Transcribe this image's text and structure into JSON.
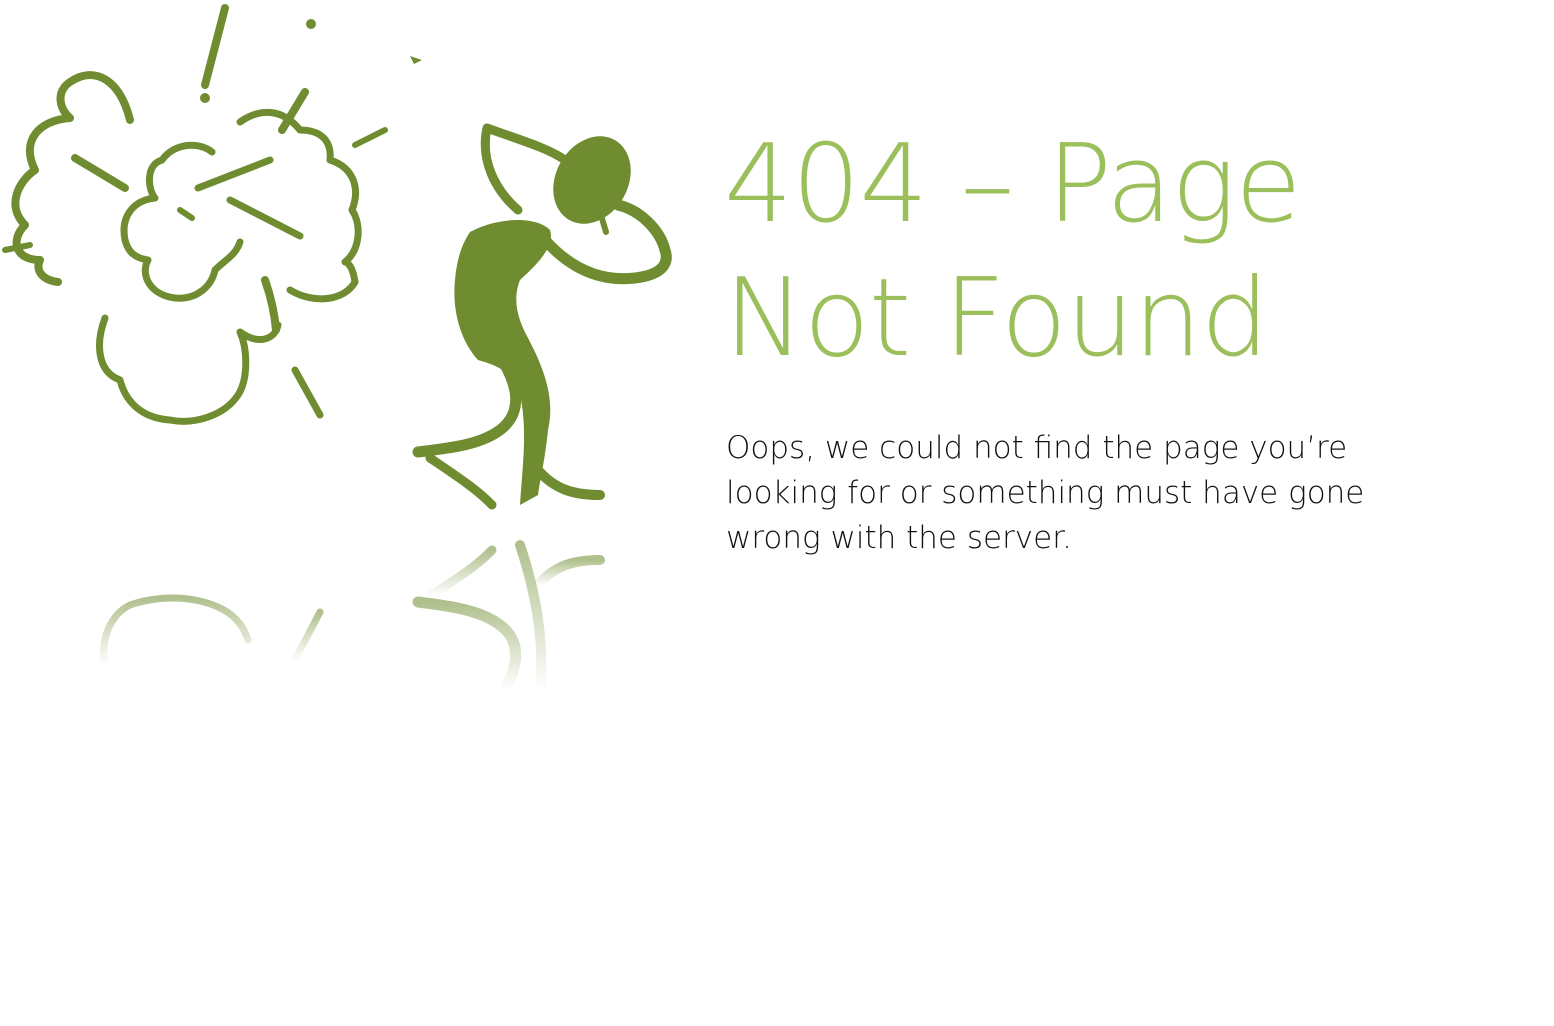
{
  "error_page": {
    "title": "404 – Page Not Found",
    "message": "Oops, we could not find the page you’re looking for or something must have gone wrong with the server."
  },
  "illustration": {
    "icons": [
      "explosion-icon",
      "stick-figure-icon",
      "reflection-icon"
    ],
    "primary_color": "#6f8c30",
    "title_color": "#9bbf5a"
  }
}
